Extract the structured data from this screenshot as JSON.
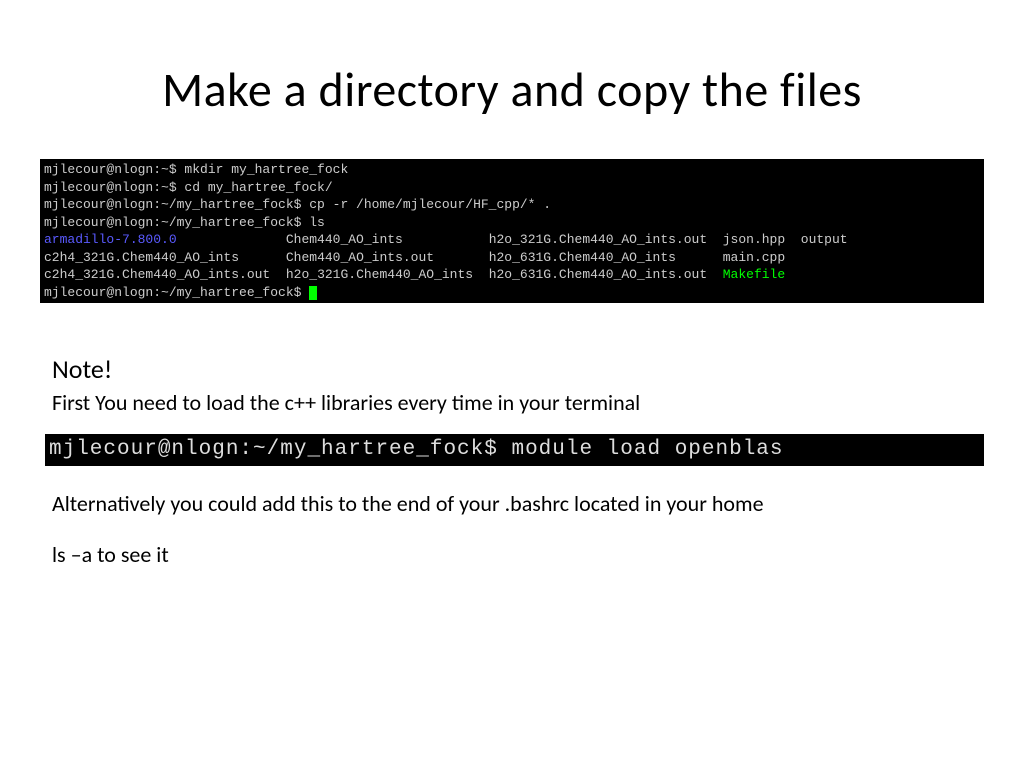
{
  "title": "Make a directory and copy the files",
  "terminal1": {
    "line1": "mjlecour@nlogn:~$ mkdir my_hartree_fock",
    "line2": "mjlecour@nlogn:~$ cd my_hartree_fock/",
    "line3": "mjlecour@nlogn:~/my_hartree_fock$ cp -r /home/mjlecour/HF_cpp/* .",
    "line4": "mjlecour@nlogn:~/my_hartree_fock$ ls",
    "ls_col1_1": "armadillo-7.800.0",
    "ls_col1_2": "c2h4_321G.Chem440_AO_ints",
    "ls_col1_3": "c2h4_321G.Chem440_AO_ints.out",
    "ls_col2_1": "Chem440_AO_ints",
    "ls_col2_2": "Chem440_AO_ints.out",
    "ls_col2_3": "h2o_321G.Chem440_AO_ints",
    "ls_col3_1": "h2o_321G.Chem440_AO_ints.out",
    "ls_col3_2": "h2o_631G.Chem440_AO_ints",
    "ls_col3_3": "h2o_631G.Chem440_AO_ints.out",
    "ls_col4_1": "json.hpp",
    "ls_col4_2": "main.cpp",
    "ls_col4_3": "Makefile",
    "ls_col5_1": "output",
    "prompt_end": "mjlecour@nlogn:~/my_hartree_fock$ "
  },
  "note_heading": "Note!",
  "note_text": "First You need to load the c++ libraries every time in your terminal",
  "terminal2": "mjlecour@nlogn:~/my_hartree_fock$ module load openblas",
  "body1": "Alternatively you could add this to the end of your .bashrc located in your home",
  "body2": "ls –a to see it"
}
